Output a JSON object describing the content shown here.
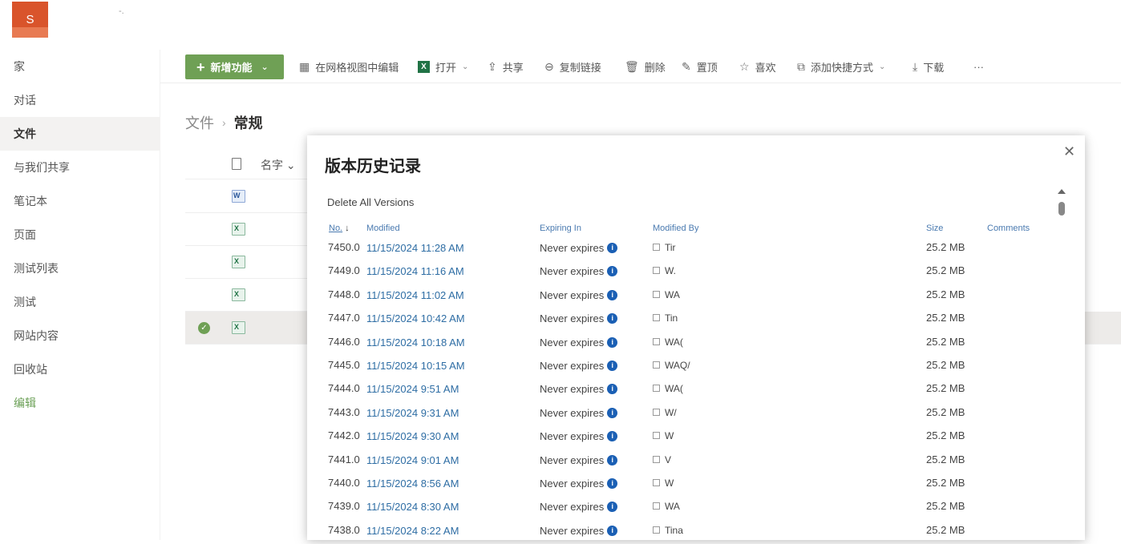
{
  "site": {
    "logo_letter": "S",
    "title_fragment": "-."
  },
  "leftnav": {
    "items": [
      {
        "label": "家",
        "name": "nav-home"
      },
      {
        "label": "对话",
        "name": "nav-conversations"
      },
      {
        "label": "文件",
        "name": "nav-files",
        "active": true
      },
      {
        "label": "与我们共享",
        "name": "nav-shared-with-us"
      },
      {
        "label": "笔记本",
        "name": "nav-notebook"
      },
      {
        "label": "页面",
        "name": "nav-pages"
      },
      {
        "label": "测试列表",
        "name": "nav-test-list"
      },
      {
        "label": "测试",
        "name": "nav-test"
      },
      {
        "label": "网站内容",
        "name": "nav-site-contents"
      },
      {
        "label": "回收站",
        "name": "nav-recycle-bin"
      },
      {
        "label": "编辑",
        "name": "nav-edit"
      }
    ]
  },
  "cmdbar": {
    "new": "新增功能",
    "grid_edit": "在网格视图中编辑",
    "open": "打开",
    "share": "共享",
    "copy_link": "复制链接",
    "delete": "删除",
    "pin": "置顶",
    "like": "喜欢",
    "add_shortcut": "添加快捷方式",
    "download": "下载",
    "more": "···"
  },
  "breadcrumb": {
    "root": "文件",
    "sep": "›",
    "current": "常规"
  },
  "filelist": {
    "name_header": "名字"
  },
  "dialog": {
    "title": "版本历史记录",
    "close": "✕",
    "delete_all": "Delete All Versions",
    "columns": {
      "no": "No.",
      "modified": "Modified",
      "expiring": "Expiring In",
      "modified_by": "Modified By",
      "size": "Size",
      "comments": "Comments"
    },
    "rows": [
      {
        "no": "7450.0",
        "modified": "11/15/2024 11:28 AM",
        "expiring": "Never expires",
        "by": "Tir",
        "size": "25.2 MB"
      },
      {
        "no": "7449.0",
        "modified": "11/15/2024 11:16 AM",
        "expiring": "Never expires",
        "by": "W.",
        "size": "25.2 MB"
      },
      {
        "no": "7448.0",
        "modified": "11/15/2024 11:02 AM",
        "expiring": "Never expires",
        "by": "WA",
        "size": "25.2 MB"
      },
      {
        "no": "7447.0",
        "modified": "11/15/2024 10:42 AM",
        "expiring": "Never expires",
        "by": "Tin",
        "size": "25.2 MB"
      },
      {
        "no": "7446.0",
        "modified": "11/15/2024 10:18 AM",
        "expiring": "Never expires",
        "by": "WA(",
        "size": "25.2 MB"
      },
      {
        "no": "7445.0",
        "modified": "11/15/2024 10:15 AM",
        "expiring": "Never expires",
        "by": "WAQ/",
        "size": "25.2 MB"
      },
      {
        "no": "7444.0",
        "modified": "11/15/2024 9:51 AM",
        "expiring": "Never expires",
        "by": "WA(",
        "size": "25.2 MB"
      },
      {
        "no": "7443.0",
        "modified": "11/15/2024 9:31 AM",
        "expiring": "Never expires",
        "by": "W/",
        "size": "25.2 MB"
      },
      {
        "no": "7442.0",
        "modified": "11/15/2024 9:30 AM",
        "expiring": "Never expires",
        "by": "W",
        "size": "25.2 MB"
      },
      {
        "no": "7441.0",
        "modified": "11/15/2024 9:01 AM",
        "expiring": "Never expires",
        "by": "V",
        "size": "25.2 MB"
      },
      {
        "no": "7440.0",
        "modified": "11/15/2024 8:56 AM",
        "expiring": "Never expires",
        "by": "W",
        "size": "25.2 MB"
      },
      {
        "no": "7439.0",
        "modified": "11/15/2024 8:30 AM",
        "expiring": "Never expires",
        "by": "WA",
        "size": "25.2 MB"
      },
      {
        "no": "7438.0",
        "modified": "11/15/2024 8:22 AM",
        "expiring": "Never expires",
        "by": "Tina",
        "size": "25.2 MB"
      }
    ]
  },
  "colors": {
    "accent_green": "#6fa055",
    "link_blue": "#2e6da4",
    "logo_orange": "#d9542b"
  }
}
